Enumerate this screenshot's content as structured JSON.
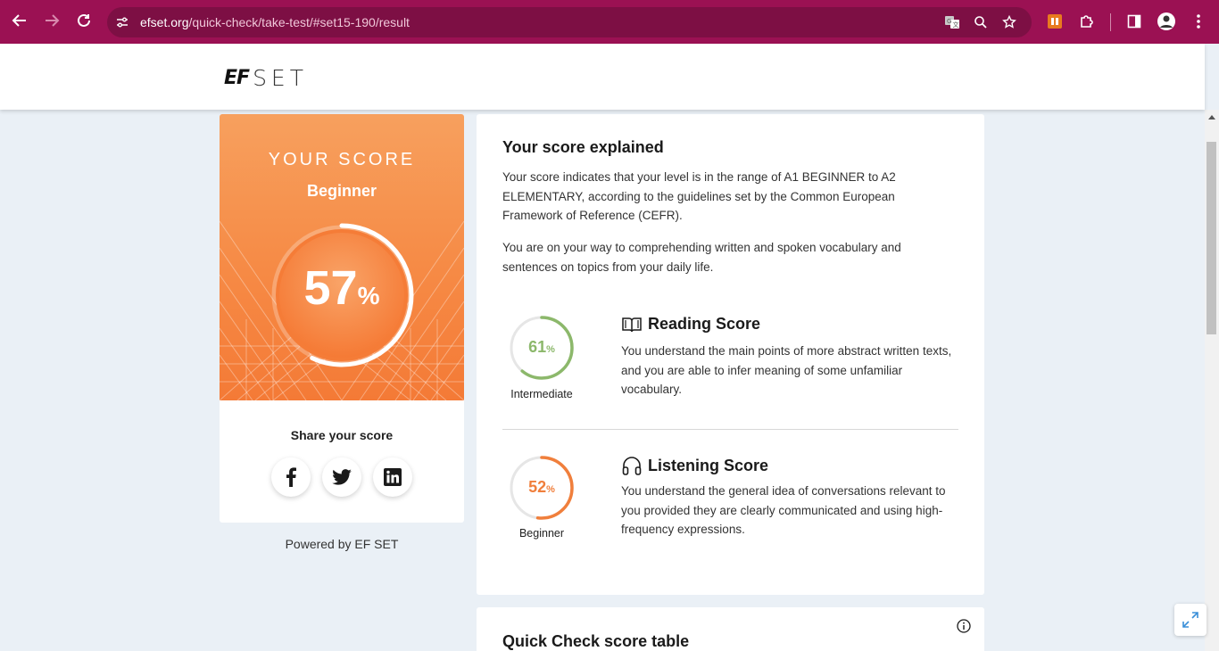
{
  "browser": {
    "url_domain": "efset.org",
    "url_path": "/quick-check/take-test/#set15-190/result"
  },
  "header": {
    "logo_ef": "EF",
    "logo_set": "SET"
  },
  "score_card": {
    "label": "YOUR SCORE",
    "level": "Beginner",
    "score": 57,
    "score_text": "57",
    "percent_symbol": "%",
    "share_title": "Share your score",
    "powered_by": "Powered by EF SET"
  },
  "explanation": {
    "title": "Your score explained",
    "paragraph_1": "Your score indicates that your level is in the range of A1 BEGINNER to A2 ELEMENTARY, according to the guidelines set by the Common European Framework of Reference (CEFR).",
    "paragraph_2": "You are on your way to comprehending written and spoken vocabulary and sentences on topics from your daily life.",
    "reading": {
      "title": "Reading Score",
      "score": 61,
      "score_text": "61",
      "percent_symbol": "%",
      "level": "Intermediate",
      "description": "You understand the main points of more abstract written texts, and you are able to infer meaning of some unfamiliar vocabulary.",
      "color": "#8cb86b"
    },
    "listening": {
      "title": "Listening Score",
      "score": 52,
      "score_text": "52",
      "percent_symbol": "%",
      "level": "Beginner",
      "description": "You understand the general idea of conversations relevant to you provided they are clearly communicated and using high-frequency expressions.",
      "color": "#f07f3c"
    }
  },
  "table_card": {
    "title": "Quick Check score table"
  },
  "colors": {
    "chrome": "#9b1153",
    "score_orange": "#f68a45",
    "page_bg": "#eaf0f6"
  }
}
